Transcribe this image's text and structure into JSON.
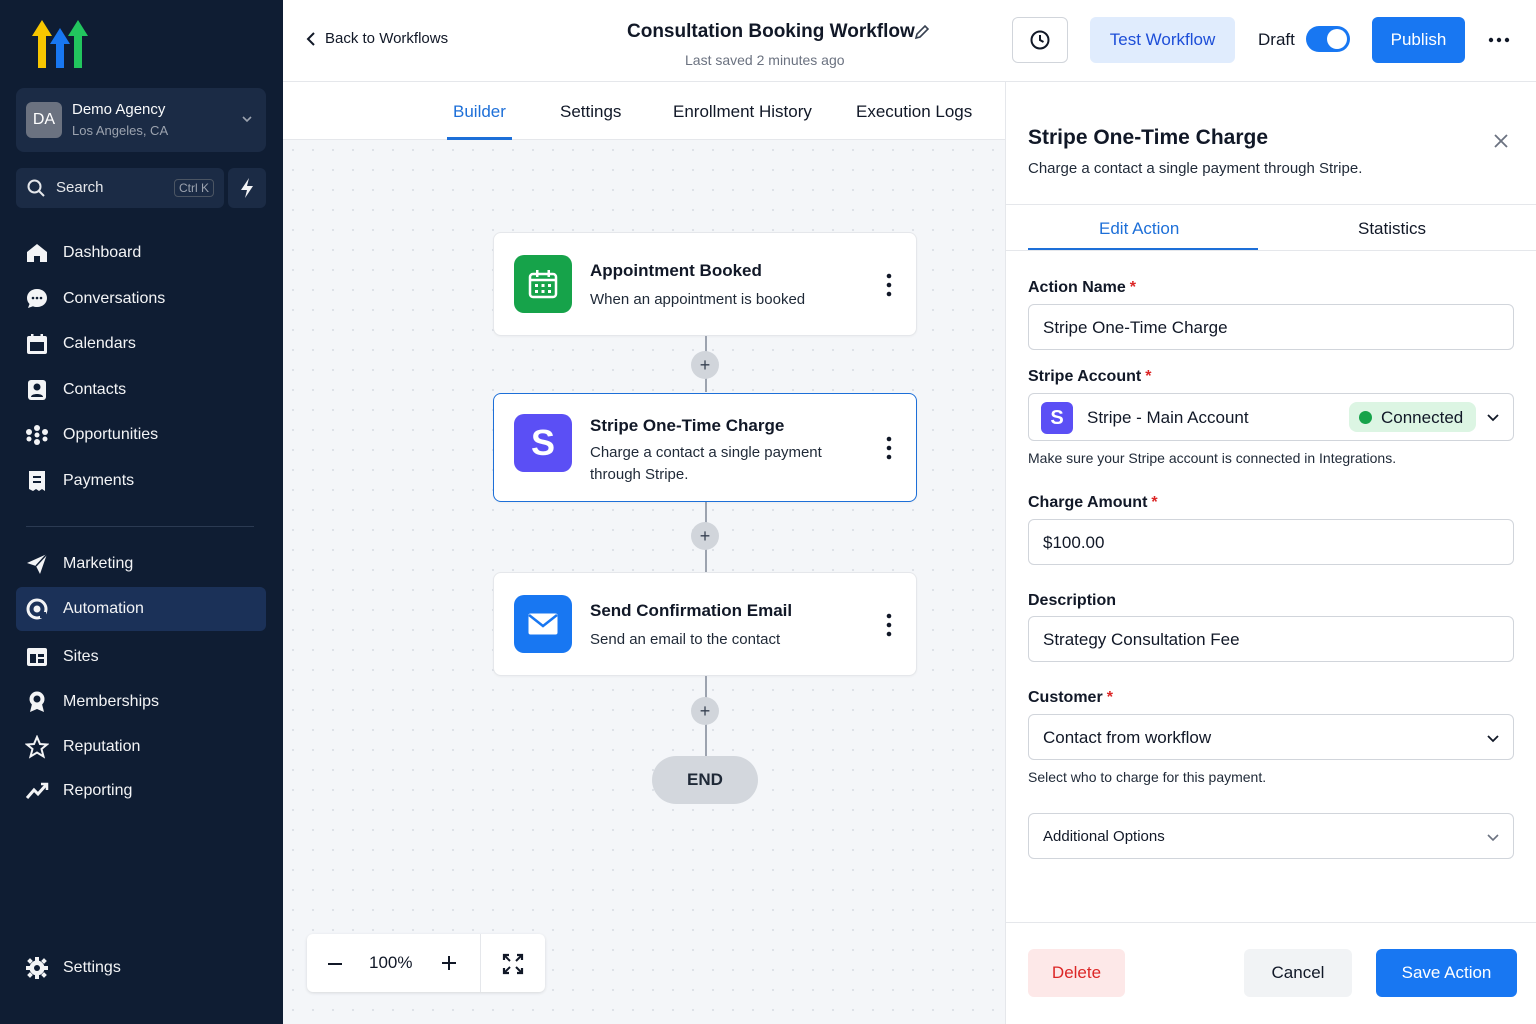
{
  "sidebar": {
    "agency": {
      "initials": "DA",
      "name": "Demo Agency",
      "location": "Los Angeles, CA"
    },
    "search": {
      "label": "Search",
      "shortcut": "Ctrl K"
    },
    "items": [
      {
        "label": "Dashboard",
        "icon": "home-icon"
      },
      {
        "label": "Conversations",
        "icon": "chat-icon"
      },
      {
        "label": "Calendars",
        "icon": "calendar-icon"
      },
      {
        "label": "Contacts",
        "icon": "contacts-icon"
      },
      {
        "label": "Opportunities",
        "icon": "opportunities-icon"
      },
      {
        "label": "Payments",
        "icon": "payments-icon"
      },
      {
        "label": "Marketing",
        "icon": "send-icon"
      },
      {
        "label": "Automation",
        "icon": "automation-icon"
      },
      {
        "label": "Sites",
        "icon": "sites-icon"
      },
      {
        "label": "Memberships",
        "icon": "badge-icon"
      },
      {
        "label": "Reputation",
        "icon": "star-icon"
      },
      {
        "label": "Reporting",
        "icon": "trend-icon"
      }
    ],
    "settings_label": "Settings"
  },
  "topbar": {
    "back_label": "Back to Workflows",
    "title": "Consultation Booking Workflow",
    "saved": "Last saved 2 minutes ago",
    "test_label": "Test Workflow",
    "draft_label": "Draft",
    "publish_label": "Publish"
  },
  "tabs": [
    "Builder",
    "Settings",
    "Enrollment History",
    "Execution Logs"
  ],
  "canvas": {
    "nodes": [
      {
        "title": "Appointment Booked",
        "desc": "When an appointment is booked"
      },
      {
        "title": "Stripe One-Time Charge",
        "desc": "Charge a contact a single payment through Stripe."
      },
      {
        "title": "Send Confirmation Email",
        "desc": "Send an email to the contact"
      }
    ],
    "plus": "+",
    "end_label": "END",
    "zoom": "100%"
  },
  "panel": {
    "title": "Stripe One-Time Charge",
    "desc": "Charge a contact a single payment through Stripe.",
    "tabs": [
      "Edit Action",
      "Statistics"
    ],
    "action_name_label": "Action Name",
    "action_name_value": "Stripe One-Time Charge",
    "stripe_account_label": "Stripe Account",
    "stripe_account_letter": "S",
    "stripe_account_value": "Stripe - Main Account",
    "stripe_status": "Connected",
    "stripe_hint": "Make sure your Stripe account is connected in Integrations.",
    "amount_label": "Charge Amount",
    "amount_value": "$100.00",
    "description_label": "Description",
    "description_value": "Strategy Consultation Fee",
    "customer_label": "Customer",
    "customer_value": "Contact from workflow",
    "customer_hint": "Select who to charge for this payment.",
    "additional_label": "Additional Options",
    "required_mark": "*",
    "delete_label": "Delete",
    "cancel_label": "Cancel",
    "save_label": "Save Action"
  },
  "colors": {
    "sidebar_bg": "#0f1d33",
    "accent": "#1877f2",
    "trigger_green": "#16a34a",
    "stripe_purple": "#5b4ff5",
    "email_blue": "#1877f2",
    "danger": "#dc2626"
  }
}
